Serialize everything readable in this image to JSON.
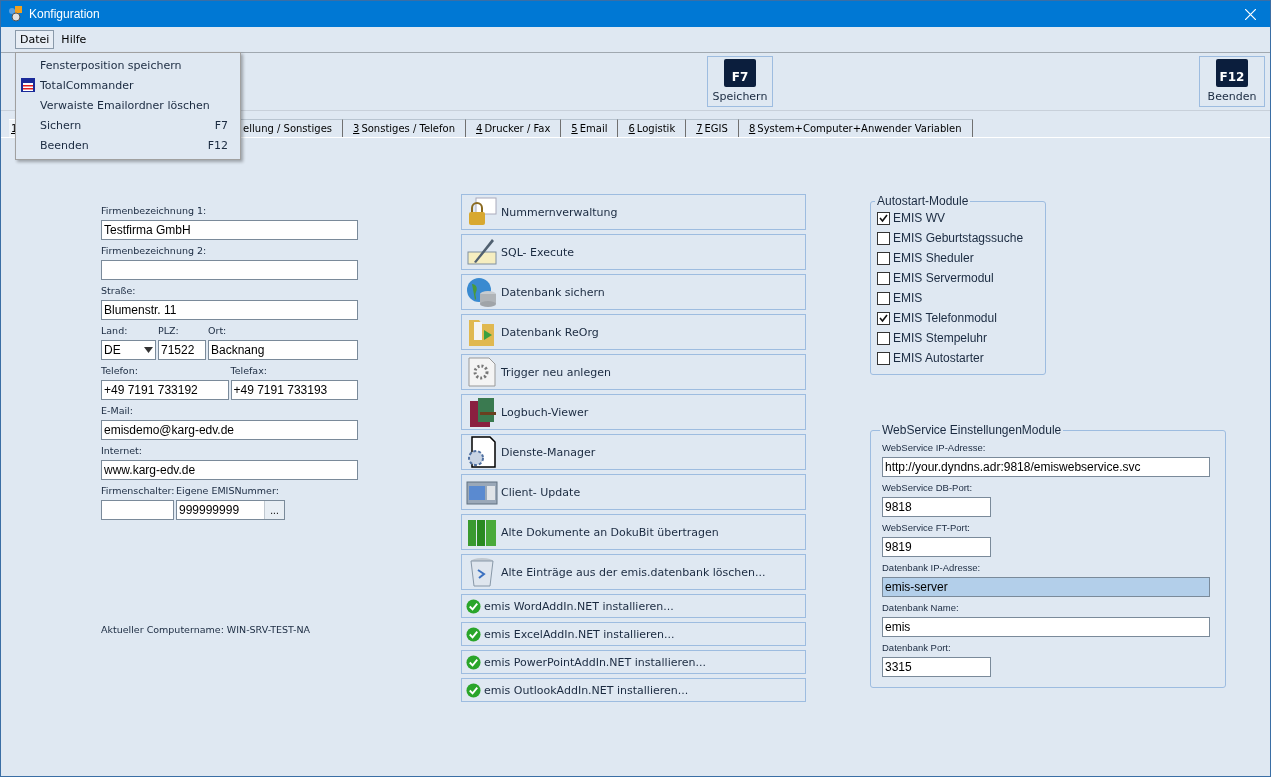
{
  "window": {
    "title": "Konfiguration"
  },
  "menubar": [
    {
      "label": "Datei",
      "open": true
    },
    {
      "label": "Hilfe",
      "open": false
    }
  ],
  "menu_items": [
    {
      "label": "Fensterposition speichern",
      "kind": "plain"
    },
    {
      "label": "TotalCommander",
      "kind": "icon"
    },
    {
      "label": "Verwaiste Emailordner löschen",
      "kind": "plain"
    },
    {
      "label": "Sichern",
      "shortcut": "F7",
      "kind": "plain"
    },
    {
      "label": "Beenden",
      "shortcut": "F12",
      "kind": "plain"
    }
  ],
  "toolbar": [
    {
      "key": "F7",
      "label": "Speichern"
    },
    {
      "key": "F12",
      "label": "Beenden"
    }
  ],
  "tabs": [
    {
      "key": "1",
      "selected": true
    },
    {
      "label": "ellung / Sonstiges",
      "selected": false
    },
    {
      "key": "3",
      "label": "Sonstiges / Telefon",
      "selected": false
    },
    {
      "key": "4",
      "label": "Drucker / Fax",
      "selected": false
    },
    {
      "key": "5",
      "label": "Email",
      "selected": false
    },
    {
      "key": "6",
      "label": "Logistik",
      "selected": false
    },
    {
      "key": "7",
      "label": "EGIS",
      "selected": false
    },
    {
      "key": "8",
      "label": "System+Computer+Anwender Variablen",
      "selected": false
    }
  ],
  "company_form": {
    "rows": [
      [
        {
          "label": "Firmenbezeichnung 1:",
          "value": "Testfirma GmbH",
          "kind": "text"
        }
      ],
      [
        {
          "label": "Firmenbezeichnung 2:",
          "kind": "text"
        }
      ],
      [
        {
          "label": "Straße:",
          "value": "Blumenstr. 11",
          "kind": "text"
        }
      ],
      [
        {
          "label": "Land:",
          "value": "DE",
          "kind": "dropdown"
        },
        {
          "label": "PLZ:",
          "value": "71522",
          "kind": "text"
        },
        {
          "label": "Ort:",
          "value": "Backnang",
          "kind": "text"
        }
      ],
      [
        {
          "label": "Telefon:",
          "value": "+49 7191 733192",
          "kind": "text"
        },
        {
          "label": "Telefax:",
          "value": "+49 7191 733193",
          "kind": "text"
        }
      ],
      [
        {
          "label": "E-Mail:",
          "value": "emisdemo@karg-edv.de",
          "kind": "text"
        }
      ],
      [
        {
          "label": "Internet:",
          "value": "www.karg-edv.de",
          "kind": "text"
        }
      ],
      [
        {
          "label": "Firmenschalter:",
          "kind": "text"
        },
        {
          "label": "Eigene EMISNummer:",
          "value": "999999999",
          "button": "...",
          "kind": "lookup"
        }
      ]
    ],
    "computer_name": "Aktueller Computername: WIN-SRV-TEST-NA"
  },
  "actions": [
    {
      "label": "Nummernverwaltung",
      "kind": "large"
    },
    {
      "label": "SQL- Execute",
      "kind": "large"
    },
    {
      "label": "Datenbank sichern",
      "kind": "large"
    },
    {
      "label": "Datenbank ReOrg",
      "kind": "large"
    },
    {
      "label": "Trigger neu anlegen",
      "kind": "large"
    },
    {
      "label": "Logbuch-Viewer",
      "kind": "large"
    },
    {
      "label": "Dienste-Manager",
      "kind": "large"
    },
    {
      "label": "Client- Update",
      "kind": "large"
    },
    {
      "label": "Alte Dokumente an DokuBit übertragen",
      "kind": "large"
    },
    {
      "label": "Alte Einträge aus der emis.datenbank löschen...",
      "kind": "large"
    },
    {
      "label": "emis WordAddIn.NET installieren...",
      "kind": "addin"
    },
    {
      "label": "emis ExcelAddIn.NET installieren...",
      "kind": "addin"
    },
    {
      "label": "emis PowerPointAddIn.NET installieren...",
      "kind": "addin"
    },
    {
      "label": "emis OutlookAddIn.NET installieren...",
      "kind": "addin"
    }
  ],
  "autostart": {
    "title": "Autostart-Module",
    "items": [
      {
        "label": "EMIS WV",
        "checked": true
      },
      {
        "label": "EMIS Geburtstagssuche",
        "checked": false
      },
      {
        "label": "EMIS Sheduler",
        "checked": false
      },
      {
        "label": "EMIS Servermodul",
        "checked": false
      },
      {
        "label": "EMIS",
        "checked": false
      },
      {
        "label": "EMIS Telefonmodul",
        "checked": true
      },
      {
        "label": "EMIS Stempeluhr",
        "checked": false
      },
      {
        "label": "EMIS Autostarter",
        "checked": false
      }
    ]
  },
  "webservice": {
    "title": "WebService EinstellungenModule",
    "fields": [
      {
        "label": "WebService IP-Adresse:",
        "value": "http://your.dyndns.adr:9818/emiswebservice.svc",
        "kind": "wide",
        "focused": false
      },
      {
        "label": "WebService DB-Port:",
        "value": "9818",
        "kind": "narrow",
        "focused": false
      },
      {
        "label": "WebService FT-Port:",
        "value": "9819",
        "kind": "narrow",
        "focused": false
      },
      {
        "label": "Datenbank IP-Adresse:",
        "value": "emis-server",
        "kind": "wide",
        "focused": true
      },
      {
        "label": "Datenbank Name:",
        "value": "emis",
        "kind": "wide",
        "focused": false
      },
      {
        "label": "Datenbank Port:",
        "value": "3315",
        "kind": "narrow",
        "focused": false
      }
    ]
  }
}
